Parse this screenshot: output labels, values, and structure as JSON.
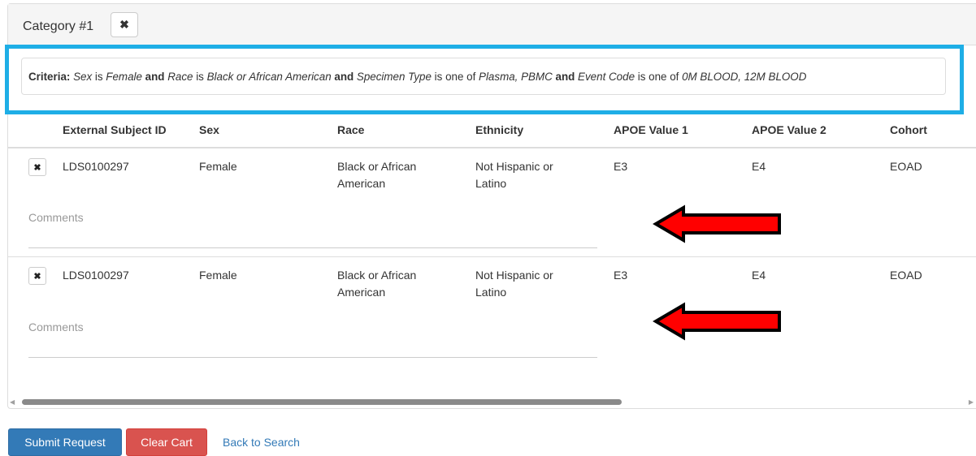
{
  "category": {
    "title": "Category #1",
    "remove_icon": "close-icon"
  },
  "criteria": {
    "label": "Criteria:",
    "parts": [
      {
        "text": "Sex",
        "style": "italic"
      },
      {
        "text": " is ",
        "style": "normal"
      },
      {
        "text": "Female",
        "style": "italic"
      },
      {
        "text": " and ",
        "style": "bold"
      },
      {
        "text": "Race",
        "style": "italic"
      },
      {
        "text": " is ",
        "style": "normal"
      },
      {
        "text": "Black or African American",
        "style": "italic"
      },
      {
        "text": " and ",
        "style": "bold"
      },
      {
        "text": "Specimen Type",
        "style": "italic"
      },
      {
        "text": " is one of ",
        "style": "normal"
      },
      {
        "text": "Plasma, PBMC",
        "style": "italic"
      },
      {
        "text": " and ",
        "style": "bold"
      },
      {
        "text": "Event Code",
        "style": "italic"
      },
      {
        "text": " is one of ",
        "style": "normal"
      },
      {
        "text": "0M BLOOD, 12M BLOOD",
        "style": "italic"
      }
    ]
  },
  "table": {
    "headers": [
      "External Subject ID",
      "Sex",
      "Race",
      "Ethnicity",
      "APOE Value 1",
      "APOE Value 2",
      "Cohort"
    ],
    "rows": [
      {
        "subject_id": "LDS0100297",
        "sex": "Female",
        "race_line1": "Black or African",
        "race_line2": "American",
        "ethnicity_line1": "Not Hispanic or",
        "ethnicity_line2": "Latino",
        "apoe1": "E3",
        "apoe2": "E4",
        "cohort": "EOAD",
        "comments_placeholder": "Comments"
      },
      {
        "subject_id": "LDS0100297",
        "sex": "Female",
        "race_line1": "Black or African",
        "race_line2": "American",
        "ethnicity_line1": "Not Hispanic or",
        "ethnicity_line2": "Latino",
        "apoe1": "E3",
        "apoe2": "E4",
        "cohort": "EOAD",
        "comments_placeholder": "Comments"
      }
    ]
  },
  "annotations": {
    "highlight_color": "#1eaee6",
    "arrow_color": "#ff0000"
  },
  "actions": {
    "submit": "Submit Request",
    "clear": "Clear Cart",
    "back": "Back to Search"
  },
  "colors": {
    "primary": "#337ab7",
    "danger": "#d9534f"
  }
}
